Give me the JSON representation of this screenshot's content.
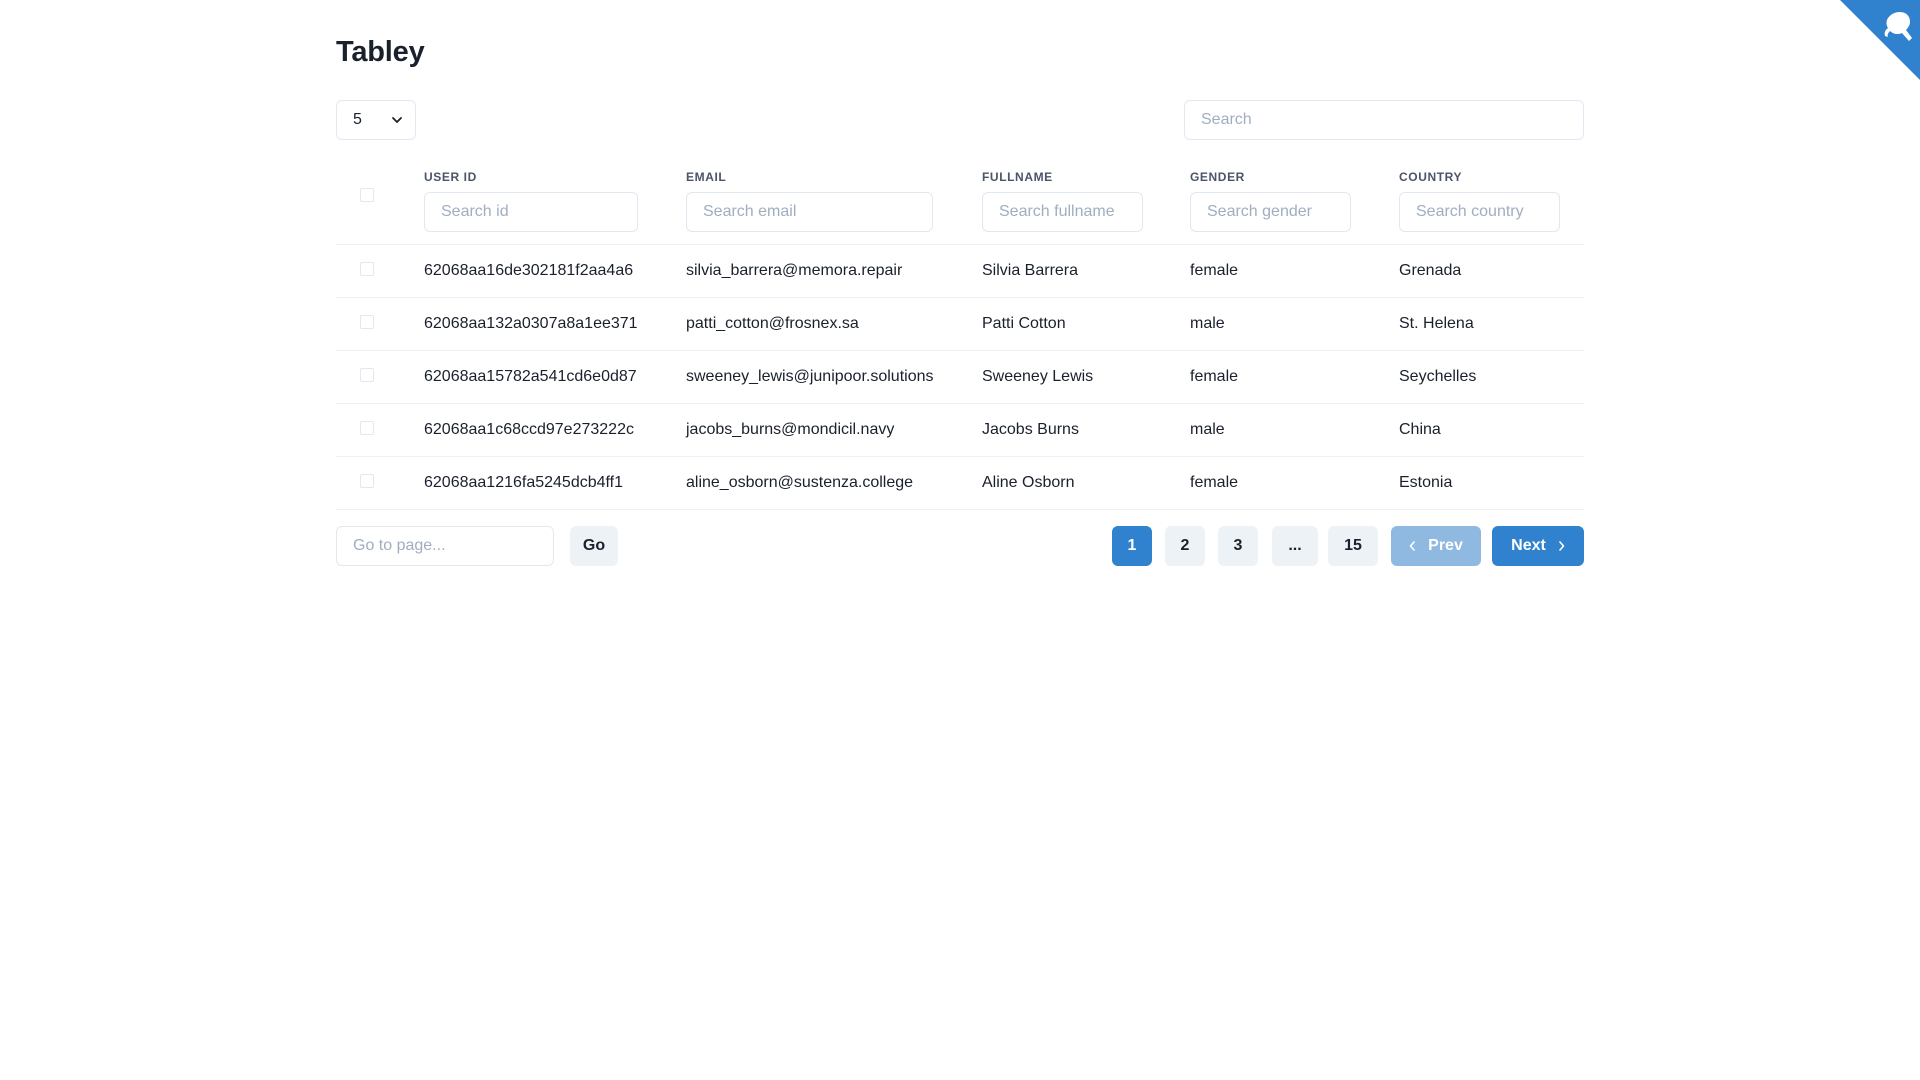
{
  "app": {
    "title": "Tabley"
  },
  "toolbar": {
    "page_size": "5",
    "search_placeholder": "Search"
  },
  "table": {
    "columns": [
      {
        "label": "USER ID",
        "filter_placeholder": "Search id"
      },
      {
        "label": "EMAIL",
        "filter_placeholder": "Search email"
      },
      {
        "label": "FULLNAME",
        "filter_placeholder": "Search fullname"
      },
      {
        "label": "GENDER",
        "filter_placeholder": "Search gender"
      },
      {
        "label": "COUNTRY",
        "filter_placeholder": "Search country"
      }
    ],
    "rows": [
      {
        "id": "62068aa16de302181f2aa4a6",
        "email": "silvia_barrera@memora.repair",
        "fullname": "Silvia Barrera",
        "gender": "female",
        "country": "Grenada"
      },
      {
        "id": "62068aa132a0307a8a1ee371",
        "email": "patti_cotton@frosnex.sa",
        "fullname": "Patti Cotton",
        "gender": "male",
        "country": "St. Helena"
      },
      {
        "id": "62068aa15782a541cd6e0d87",
        "email": "sweeney_lewis@junipoor.solutions",
        "fullname": "Sweeney Lewis",
        "gender": "female",
        "country": "Seychelles"
      },
      {
        "id": "62068aa1c68ccd97e273222c",
        "email": "jacobs_burns@mondicil.navy",
        "fullname": "Jacobs Burns",
        "gender": "male",
        "country": "China"
      },
      {
        "id": "62068aa1216fa5245dcb4ff1",
        "email": "aline_osborn@sustenza.college",
        "fullname": "Aline Osborn",
        "gender": "female",
        "country": "Estonia"
      }
    ]
  },
  "pagination": {
    "goto_placeholder": "Go to page...",
    "go_label": "Go",
    "pages": [
      "1",
      "2",
      "3",
      "...",
      "15"
    ],
    "current_page": "1",
    "prev_label": "Prev",
    "next_label": "Next"
  },
  "colors": {
    "accent": "#3182ce",
    "accent_disabled": "#90b9e2",
    "button_gray": "#edf2f7",
    "border": "#e2e8f0",
    "text": "#1a202c",
    "header_text": "#4a5568"
  },
  "icons": {
    "select_chevron": "chevron-down-icon",
    "prev_arrow": "chevron-left-icon",
    "next_arrow": "chevron-right-icon",
    "corner": "github-corner-icon"
  }
}
